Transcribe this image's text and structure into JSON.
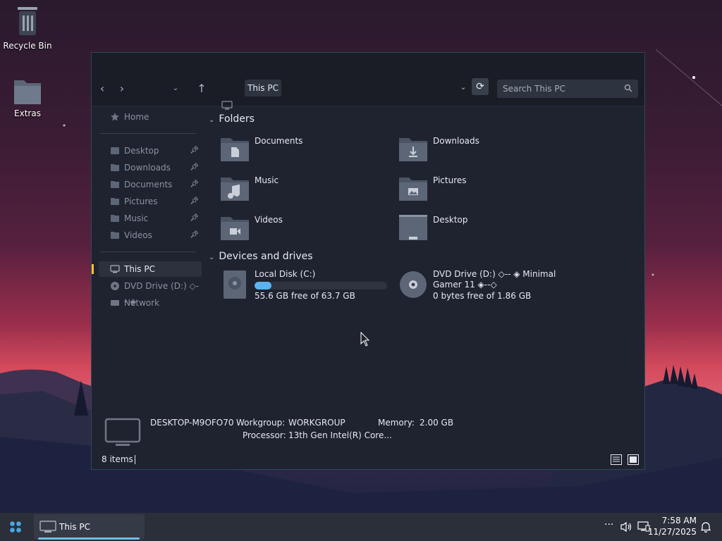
{
  "desktop": {
    "icons": [
      {
        "label": "Recycle Bin"
      },
      {
        "label": "Extras"
      }
    ]
  },
  "window": {
    "address": "This PC",
    "search_placeholder": "Search This PC"
  },
  "sidebar": {
    "home": "Home",
    "quick": [
      {
        "label": "Desktop"
      },
      {
        "label": "Downloads"
      },
      {
        "label": "Documents"
      },
      {
        "label": "Pictures"
      },
      {
        "label": "Music"
      },
      {
        "label": "Videos"
      }
    ],
    "this_pc": "This PC",
    "dvd": "DVD Drive (D:) ◇-- ◈",
    "network": "Network"
  },
  "folders": {
    "header": "Folders",
    "items": [
      {
        "label": "Documents",
        "icon": "document-icon"
      },
      {
        "label": "Downloads",
        "icon": "download-icon"
      },
      {
        "label": "Music",
        "icon": "music-icon"
      },
      {
        "label": "Pictures",
        "icon": "picture-icon"
      },
      {
        "label": "Videos",
        "icon": "video-icon"
      },
      {
        "label": "Desktop",
        "icon": "desktop-icon"
      }
    ]
  },
  "drives": {
    "header": "Devices and drives",
    "local": {
      "label": "Local Disk (C:)",
      "free": "55.6 GB free of 63.7 GB",
      "used_fraction": 0.13
    },
    "dvd": {
      "line1": "DVD Drive (D:) ◇-- ◈ Minimal",
      "line2": "Gamer 11 ◈--◇",
      "free": "0 bytes free of 1.86 GB"
    }
  },
  "details": {
    "computer_name": "DESKTOP-M9OFO70",
    "workgroup_label": "Workgroup:",
    "workgroup": "WORKGROUP",
    "memory_label": "Memory:",
    "memory": "2.00 GB",
    "processor_label": "Processor:",
    "processor": "13th Gen Intel(R) Core..."
  },
  "status": {
    "count": "8 items"
  },
  "taskbar": {
    "app_label": "This PC",
    "time": "7:58 AM",
    "date": "11/27/2025"
  }
}
